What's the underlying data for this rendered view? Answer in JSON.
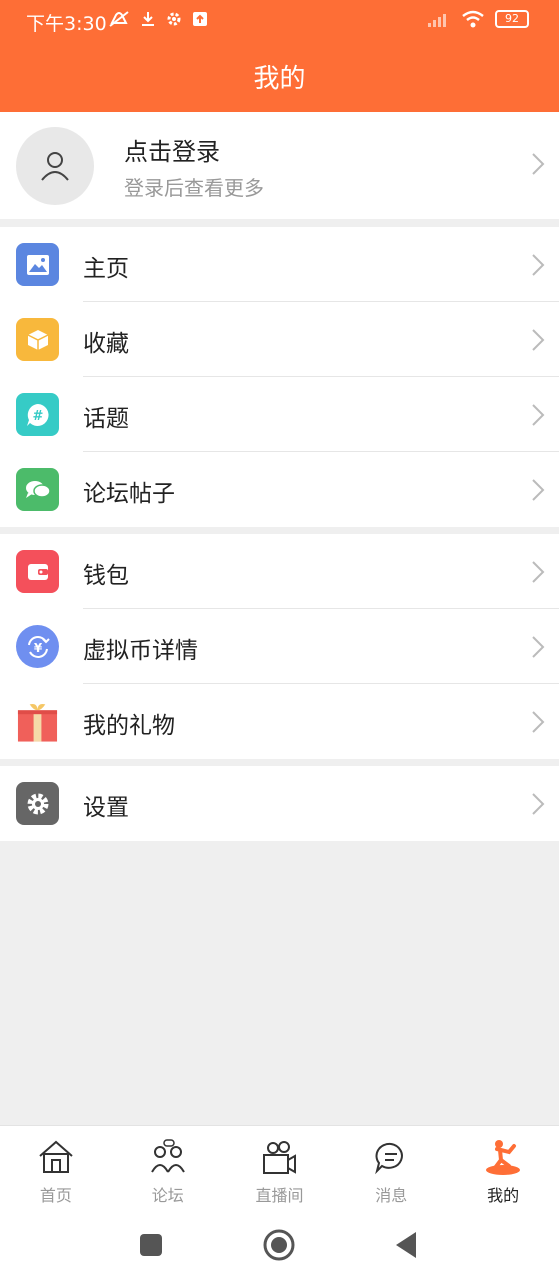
{
  "status_bar": {
    "time": "下午3:30",
    "battery": "92"
  },
  "header": {
    "title": "我的"
  },
  "profile": {
    "title": "点击登录",
    "subtitle": "登录后查看更多"
  },
  "menu_groups": [
    {
      "items": [
        {
          "label": "主页",
          "icon": "image-icon",
          "color": "#5b86e0"
        },
        {
          "label": "收藏",
          "icon": "box-icon",
          "color": "#f8b83c"
        },
        {
          "label": "话题",
          "icon": "topic-hash-icon",
          "color": "#36cbc6"
        },
        {
          "label": "论坛帖子",
          "icon": "chat-bubbles-icon",
          "color": "#4cbb6a"
        }
      ]
    },
    {
      "items": [
        {
          "label": "钱包",
          "icon": "wallet-icon",
          "color": "#f4505b"
        },
        {
          "label": "虚拟币详情",
          "icon": "yuan-exchange-icon",
          "color": "#6f8ff0"
        },
        {
          "label": "我的礼物",
          "icon": "gift-icon",
          "color": "#f0605a"
        }
      ]
    },
    {
      "items": [
        {
          "label": "设置",
          "icon": "gear-icon",
          "color": "#666666"
        }
      ]
    }
  ],
  "bottom_nav": [
    {
      "label": "首页",
      "icon": "home-icon",
      "active": false
    },
    {
      "label": "论坛",
      "icon": "forum-icon",
      "active": false
    },
    {
      "label": "直播间",
      "icon": "camera-icon",
      "active": false
    },
    {
      "label": "消息",
      "icon": "message-icon",
      "active": false
    },
    {
      "label": "我的",
      "icon": "profile-figure-icon",
      "active": true
    }
  ],
  "accent_color": "#fe6e36"
}
